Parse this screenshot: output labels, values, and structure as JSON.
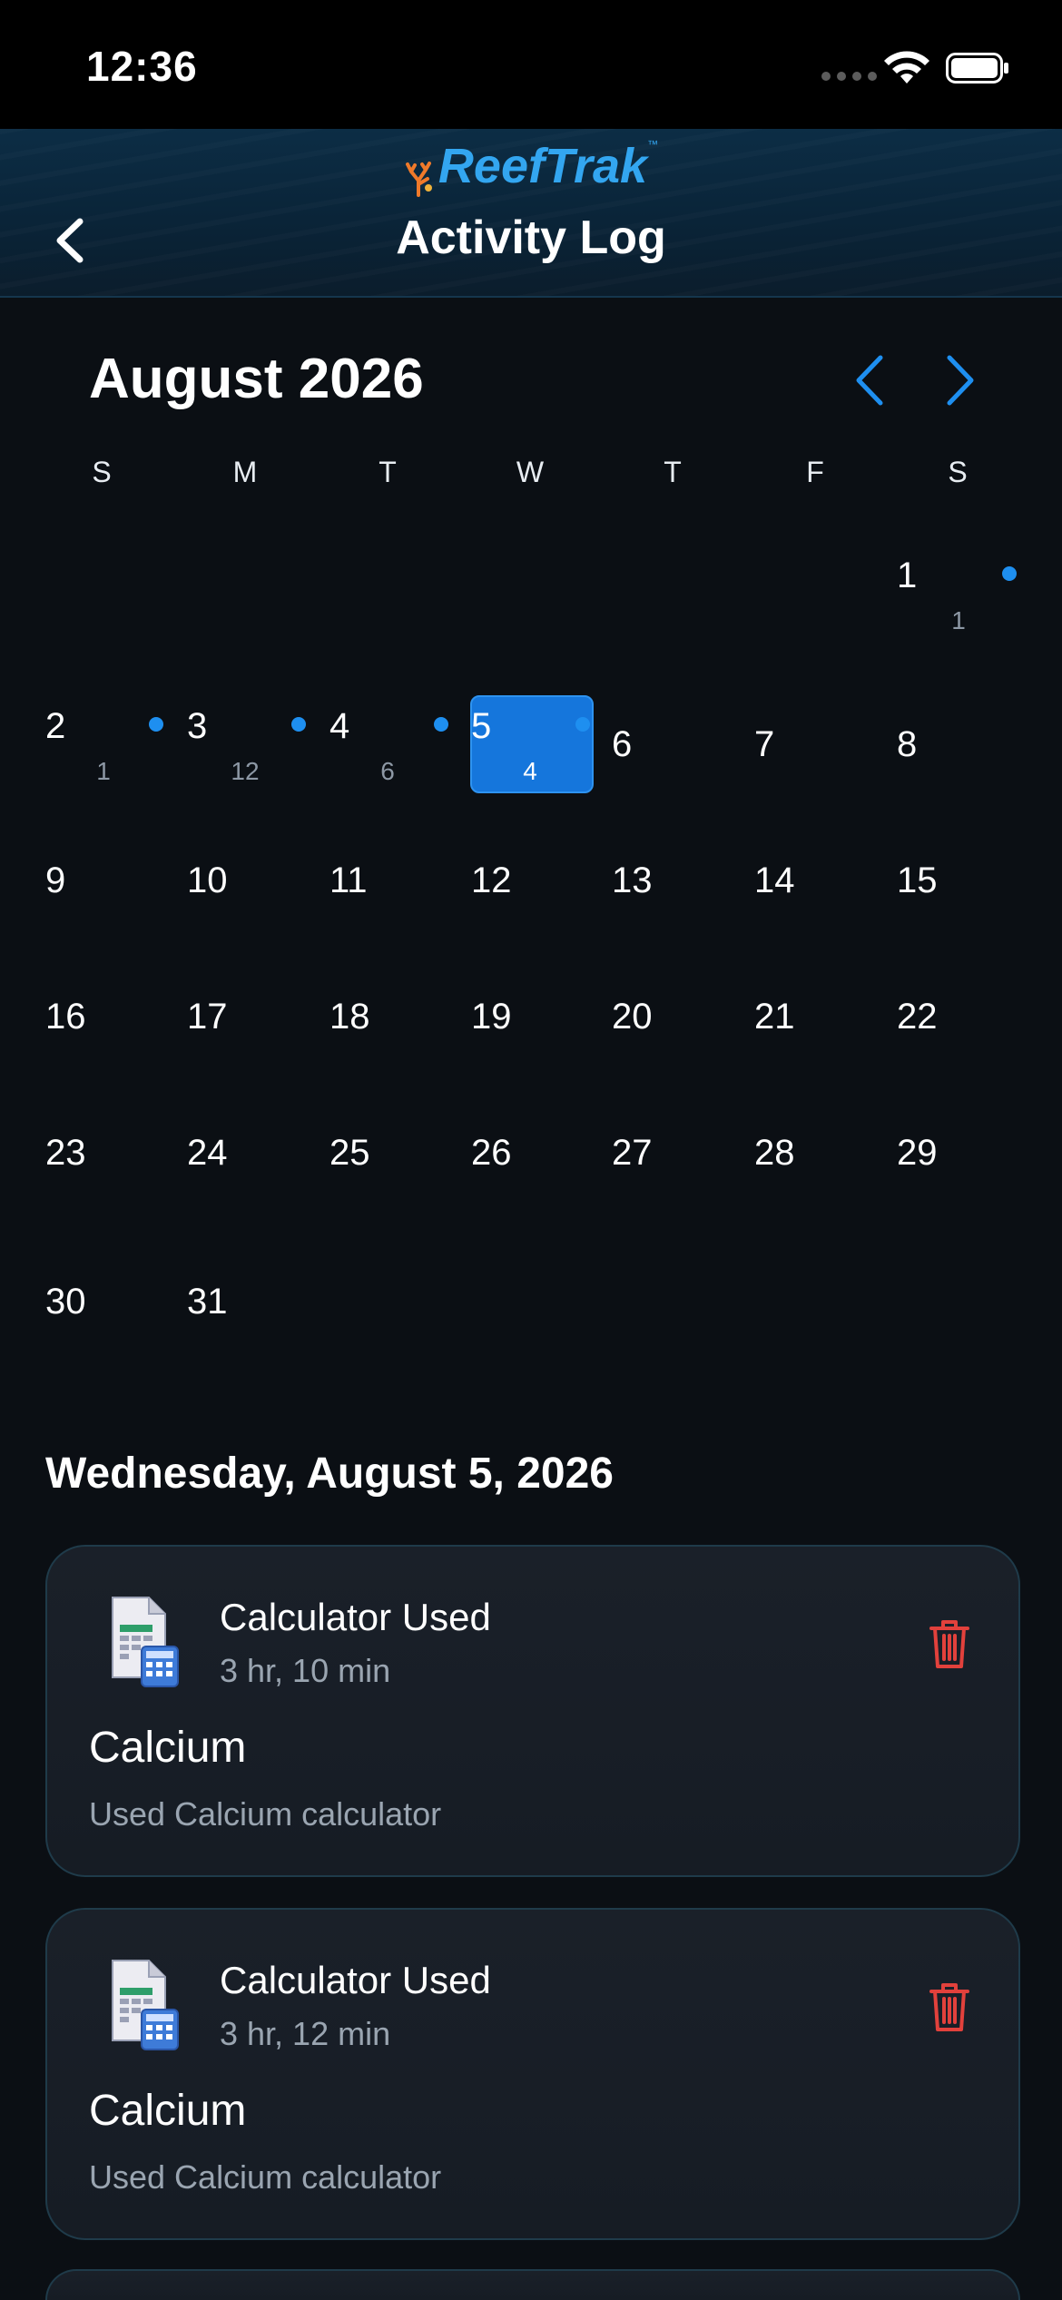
{
  "status": {
    "time": "12:36"
  },
  "header": {
    "logo_text": "ReefTrak",
    "title": "Activity Log"
  },
  "calendar": {
    "month_title": "August 2026",
    "weekdays": [
      "S",
      "M",
      "T",
      "W",
      "T",
      "F",
      "S"
    ],
    "selected_day": "5",
    "days": {
      "d1": "1",
      "d2": "2",
      "d3": "3",
      "d4": "4",
      "d5": "5",
      "d6": "6",
      "d7": "7",
      "d8": "8",
      "d9": "9",
      "d10": "10",
      "d11": "11",
      "d12": "12",
      "d13": "13",
      "d14": "14",
      "d15": "15",
      "d16": "16",
      "d17": "17",
      "d18": "18",
      "d19": "19",
      "d20": "20",
      "d21": "21",
      "d22": "22",
      "d23": "23",
      "d24": "24",
      "d25": "25",
      "d26": "26",
      "d27": "27",
      "d28": "28",
      "d29": "29",
      "d30": "30",
      "d31": "31"
    },
    "activity_counts": {
      "d1": "1",
      "d2": "1",
      "d3": "12",
      "d4": "6",
      "d5": "4"
    },
    "accent_color": "#1e8ff0"
  },
  "selected_date_heading": "Wednesday, August 5, 2026",
  "activities": [
    {
      "type": "Calculator Used",
      "time_ago": "3 hr, 10 min",
      "name": "Calcium",
      "description": "Used Calcium calculator",
      "icon": "calculator-spreadsheet-icon"
    },
    {
      "type": "Calculator Used",
      "time_ago": "3 hr, 12 min",
      "name": "Calcium",
      "description": "Used Calcium calculator",
      "icon": "calculator-spreadsheet-icon"
    }
  ]
}
